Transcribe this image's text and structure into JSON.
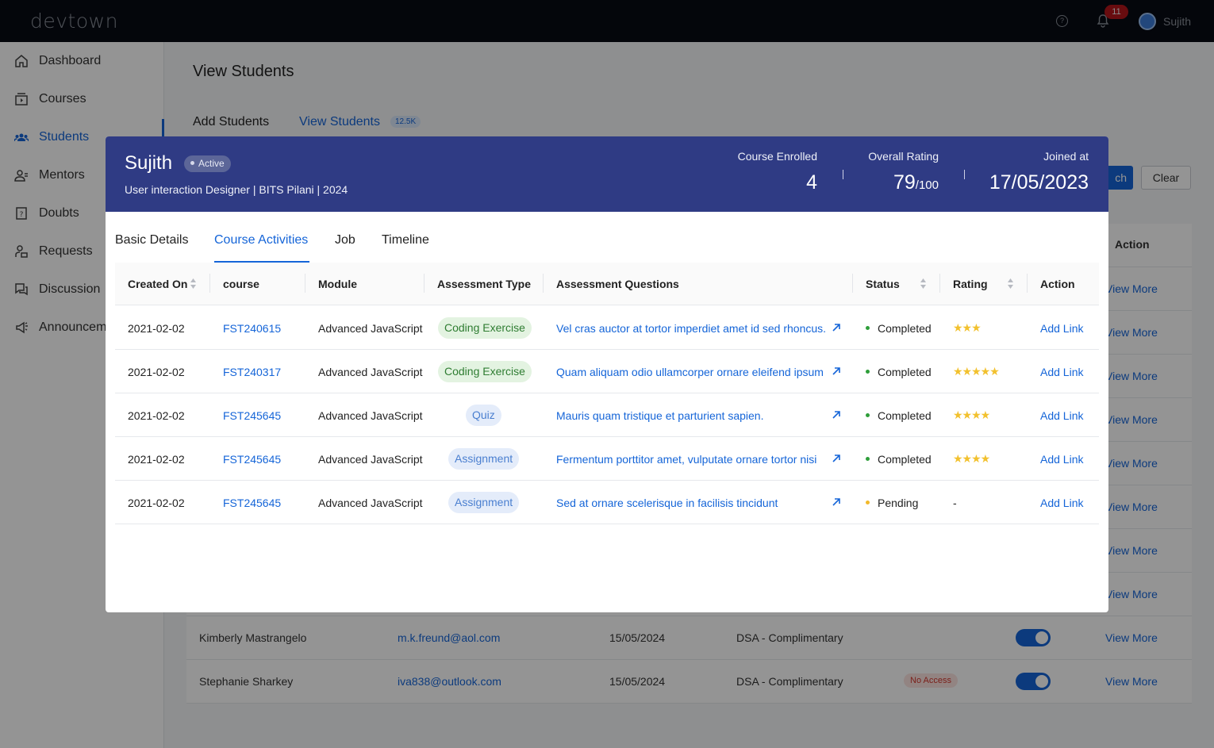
{
  "app": {
    "logo": "devtown",
    "username": "Sujith",
    "notifications": "11"
  },
  "sidebar": {
    "items": [
      {
        "label": "Dashboard",
        "icon": "home-icon"
      },
      {
        "label": "Courses",
        "icon": "courses-icon"
      },
      {
        "label": "Students",
        "icon": "students-icon",
        "active": true
      },
      {
        "label": "Mentors",
        "icon": "mentors-icon"
      },
      {
        "label": "Doubts",
        "icon": "doubts-icon"
      },
      {
        "label": "Requests",
        "icon": "requests-icon"
      },
      {
        "label": "Discussion",
        "icon": "discussion-icon"
      },
      {
        "label": "Announcem",
        "icon": "announcement-icon"
      }
    ]
  },
  "page": {
    "title": "View Students",
    "tabs": [
      "Add Students",
      "View Students"
    ],
    "view_count": "12.5K",
    "search_label": "ch",
    "clear_label": "Clear",
    "action_header": "Action",
    "view_more": "View More",
    "rows": [
      {
        "name": "Kimberly Mastrangelo",
        "email": "m.k.freund@aol.com",
        "date": "15/05/2024",
        "course": "DSA - Complimentary",
        "access": ""
      },
      {
        "name": "Stephanie Sharkey",
        "email": "iva838@outlook.com",
        "date": "15/05/2024",
        "course": "DSA - Complimentary",
        "access": "No Access"
      }
    ]
  },
  "modal": {
    "name": "Sujith",
    "status": "Active",
    "subtitle": "User interaction Designer | BITS Pilani | 2024",
    "stats": {
      "enrolled_label": "Course Enrolled",
      "enrolled_value": "4",
      "rating_label": "Overall Rating",
      "rating_value": "79",
      "rating_max": "/100",
      "joined_label": "Joined at",
      "joined_value": "17/05/2023"
    },
    "tabs": [
      "Basic Details",
      "Course Activities",
      "Job",
      "Timeline"
    ],
    "active_tab": "Course Activities",
    "table": {
      "headers": [
        "Created On",
        "course",
        "Module",
        "Assessment Type",
        "Assessment Questions",
        "Status",
        "Rating",
        "Action"
      ],
      "rows": [
        {
          "created": "2021-02-02",
          "course": "FST240615",
          "module": "Advanced JavaScript",
          "type": "Coding Exercise",
          "question": "Vel cras auctor at tortor imperdiet amet id sed rhoncus.",
          "status": "Completed",
          "stars": "★★★",
          "rating": 3,
          "action": "Add Link"
        },
        {
          "created": "2021-02-02",
          "course": "FST240317",
          "module": "Advanced JavaScript",
          "type": "Coding Exercise",
          "question": "Quam aliquam odio ullamcorper ornare eleifend ipsum",
          "status": "Completed",
          "stars": "★★★★★",
          "rating": 5,
          "action": "Add Link"
        },
        {
          "created": "2021-02-02",
          "course": "FST245645",
          "module": "Advanced JavaScript",
          "type": "Quiz",
          "question": "Mauris quam tristique et parturient sapien.",
          "status": "Completed",
          "stars": "★★★★",
          "rating": 4,
          "action": "Add Link"
        },
        {
          "created": "2021-02-02",
          "course": "FST245645",
          "module": "Advanced JavaScript",
          "type": "Assignment",
          "question": "Fermentum porttitor amet, vulputate ornare tortor nisi",
          "status": "Completed",
          "stars": "★★★★",
          "rating": 4,
          "action": "Add Link"
        },
        {
          "created": "2021-02-02",
          "course": "FST245645",
          "module": "Advanced JavaScript",
          "type": "Assignment",
          "question": "Sed at ornare scelerisque in facilisis tincidunt",
          "status": "Pending",
          "stars": "-",
          "rating": 0,
          "action": "Add Link"
        }
      ]
    }
  },
  "colors": {
    "accent": "#1565d8",
    "header": "#2f3b84",
    "completed": "#2e9e3a",
    "pending": "#f2b92b",
    "star": "#f2c12e"
  }
}
